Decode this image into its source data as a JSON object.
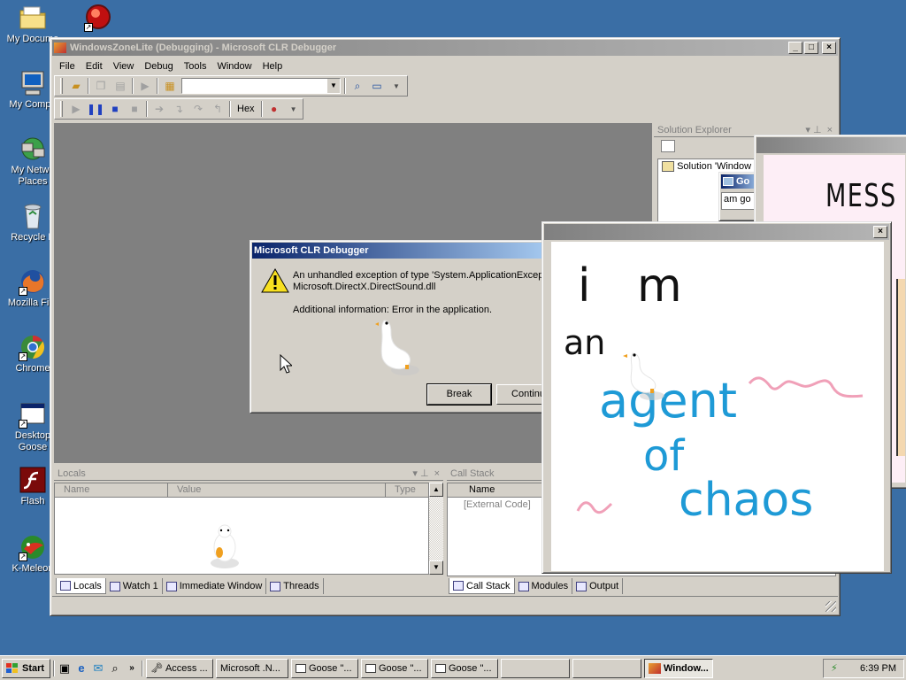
{
  "desktop": {
    "icons": [
      {
        "label": "My Docume",
        "icon": "folder-icon"
      },
      {
        "label": "",
        "icon": "red-app-icon"
      },
      {
        "label": "My Compu",
        "icon": "computer-icon"
      },
      {
        "label": "My Netwo",
        "label2": "Places",
        "icon": "network-icon"
      },
      {
        "label": "Recycle B",
        "icon": "recycle-bin-icon"
      },
      {
        "label": "Mozilla Fire",
        "icon": "firefox-icon"
      },
      {
        "label": "Chrome",
        "icon": "chrome-icon"
      },
      {
        "label": "Desktop",
        "label2": "Goose",
        "icon": "window-app-icon"
      },
      {
        "label": "Flash",
        "icon": "flash-icon"
      },
      {
        "label": "K-Meleon",
        "icon": "kmeleon-icon"
      }
    ]
  },
  "debugger": {
    "title": "WindowsZoneLite (Debugging) - Microsoft CLR Debugger",
    "menu": [
      "File",
      "Edit",
      "View",
      "Debug",
      "Tools",
      "Window",
      "Help"
    ],
    "hex_label": "Hex",
    "solution_explorer": {
      "title": "Solution Explorer",
      "item": "Solution 'Window"
    },
    "locals": {
      "title": "Locals",
      "columns": [
        "Name",
        "Value",
        "Type"
      ]
    },
    "call_stack": {
      "title": "Call Stack",
      "column": "Name",
      "row": "[External Code]"
    },
    "left_tabs": [
      "Locals",
      "Watch 1",
      "Immediate Window",
      "Threads"
    ],
    "right_tabs": [
      "Call Stack",
      "Modules",
      "Output"
    ]
  },
  "dialog": {
    "title": "Microsoft CLR Debugger",
    "message_line1": "An unhandled exception of type 'System.ApplicationExcep",
    "message_line2": "Microsoft.DirectX.DirectSound.dll",
    "additional": "Additional information: Error in the application.",
    "break_button": "Break",
    "continue_button": "Continu"
  },
  "small_popup": {
    "title": "Go",
    "text": "am go"
  },
  "mess_note": {
    "text": "MESS WI"
  },
  "goose_note": {
    "lines": [
      "i m",
      "an",
      "agent",
      "of",
      "chaos"
    ],
    "colors": {
      "black": "#111111",
      "blue": "#1e9ad6",
      "pink": "#f0a0b8"
    }
  },
  "taskbar": {
    "start_label": "Start",
    "tasks": [
      {
        "label": "Access ...",
        "active": false
      },
      {
        "label": "Microsoft .N...",
        "active": false
      },
      {
        "label": "Goose \"...",
        "active": false
      },
      {
        "label": "Goose \"...",
        "active": false
      },
      {
        "label": "Goose \"...",
        "active": false
      },
      {
        "label": "",
        "active": false
      },
      {
        "label": "",
        "active": false
      },
      {
        "label": "Window...",
        "active": true
      }
    ],
    "clock": "6:39 PM"
  },
  "colors": {
    "desktop": "#3a6ea5",
    "title_active": "#0a246a",
    "title_inactive": "#808080"
  }
}
